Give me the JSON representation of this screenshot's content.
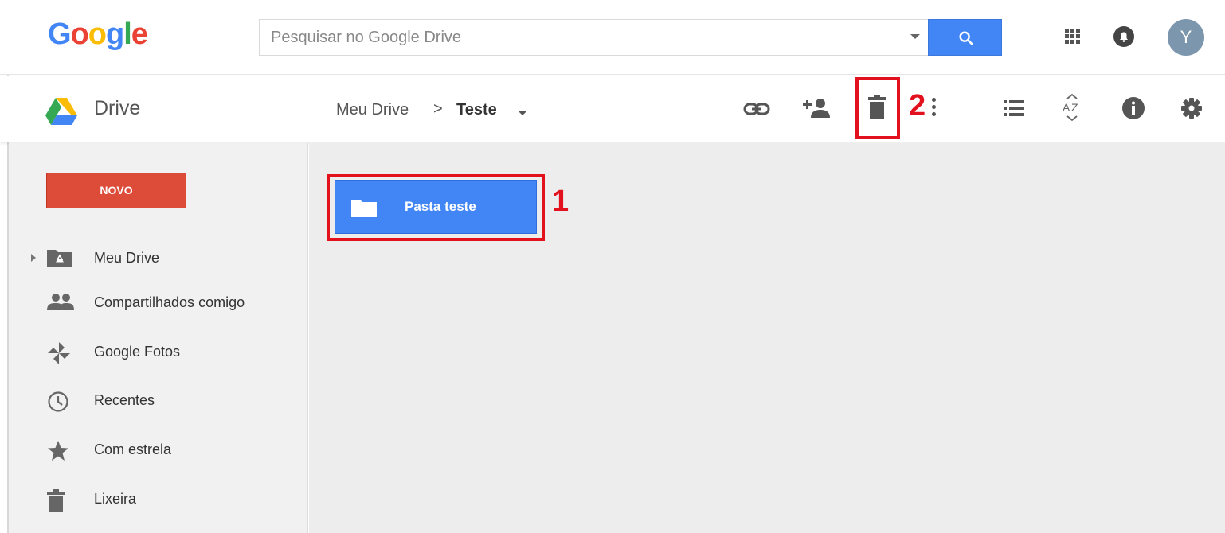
{
  "header": {
    "logo_letters": [
      {
        "char": "G",
        "color": "#4285f4"
      },
      {
        "char": "o",
        "color": "#ea4335"
      },
      {
        "char": "o",
        "color": "#fbbc05"
      },
      {
        "char": "g",
        "color": "#4285f4"
      },
      {
        "char": "l",
        "color": "#34a853"
      },
      {
        "char": "e",
        "color": "#ea4335"
      }
    ],
    "search": {
      "placeholder": "Pesquisar no Google Drive",
      "value": "",
      "button_icon": "search-icon",
      "dropdown_icon": "caret-down-icon"
    },
    "apps_icon": "apps-grid-icon",
    "notifications_icon": "bell-icon",
    "avatar_initial": "Y",
    "avatar_color": "#7b96ad"
  },
  "subbar": {
    "app_name": "Drive",
    "breadcrumb": {
      "root": "Meu Drive",
      "separator": ">",
      "current": "Teste"
    },
    "toolbar_icons": [
      "link-icon",
      "add-person-icon",
      "trash-icon",
      "more-vert-icon",
      "list-view-icon",
      "sort-az-icon",
      "info-icon",
      "settings-icon"
    ],
    "annotation_2": "2"
  },
  "sidebar": {
    "new_button_label": "NOVO",
    "items": [
      {
        "label": "Meu Drive",
        "icon": "my-drive-folder-icon"
      },
      {
        "label": "Compartilhados comigo",
        "icon": "people-icon"
      },
      {
        "label": "Google Fotos",
        "icon": "photos-pinwheel-icon"
      },
      {
        "label": "Recentes",
        "icon": "clock-icon"
      },
      {
        "label": "Com estrela",
        "icon": "star-icon"
      },
      {
        "label": "Lixeira",
        "icon": "trash-icon"
      }
    ]
  },
  "main": {
    "folders": [
      {
        "name": "Pasta teste",
        "icon": "folder-icon"
      }
    ],
    "annotation_1": "1"
  },
  "colors": {
    "accent_blue": "#4285f4",
    "new_button_red": "#dd4b39",
    "annotation_red": "#e3101d",
    "sidebar_bg": "#f1f1f1",
    "main_bg": "#ededed"
  }
}
